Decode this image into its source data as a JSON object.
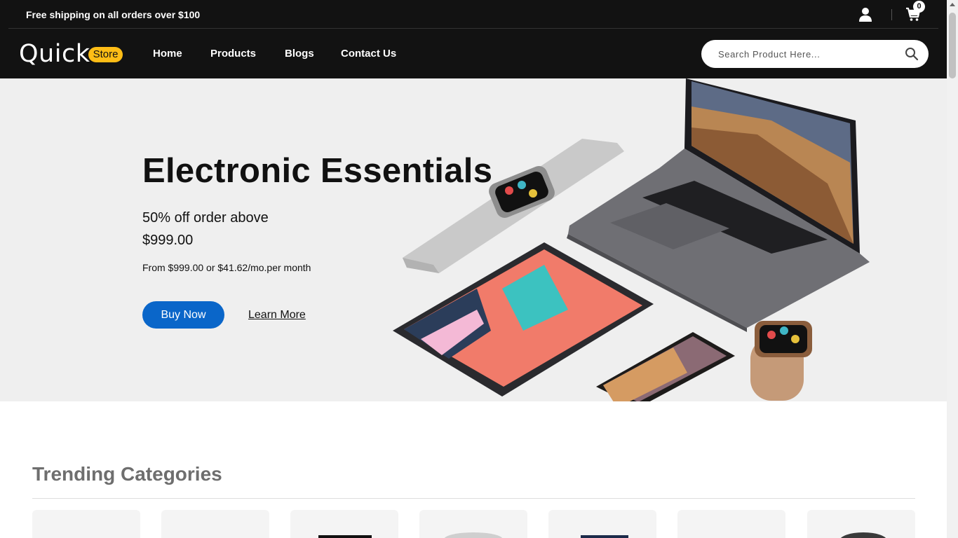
{
  "topbar": {
    "shipping_text": "Free shipping on all orders over $100",
    "cart_count": "0",
    "icons": [
      "user-icon",
      "cart-icon"
    ]
  },
  "header": {
    "logo_main": "Quick",
    "logo_badge": "Store",
    "nav": [
      "Home",
      "Products",
      "Blogs",
      "Contact Us"
    ],
    "search_placeholder": "Search Product Here..."
  },
  "hero": {
    "title": "Electronic Essentials",
    "subtitle": "50% off order above",
    "price": "$999.00",
    "finance": "From $999.00 or $41.62/mo.per month",
    "buy_label": "Buy Now",
    "learn_label": "Learn More"
  },
  "trending": {
    "title": "Trending Categories"
  },
  "colors": {
    "header_bg": "#121212",
    "accent_yellow": "#febd16",
    "button_blue": "#0a66c9",
    "hero_bg": "#efefef"
  }
}
